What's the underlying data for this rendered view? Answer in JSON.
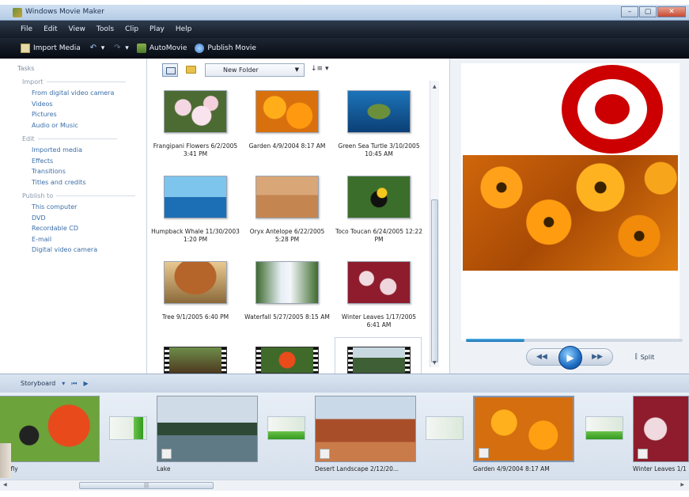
{
  "window": {
    "title": "Windows Movie Maker"
  },
  "menu": [
    "File",
    "Edit",
    "View",
    "Tools",
    "Clip",
    "Play",
    "Help"
  ],
  "toolbar": {
    "import_label": "Import Media",
    "automovie_label": "AutoMovie",
    "publish_label": "Publish Movie"
  },
  "tasks": {
    "header": "Tasks",
    "sections": [
      {
        "title": "Import",
        "links": [
          "From digital video camera",
          "Videos",
          "Pictures",
          "Audio or Music"
        ]
      },
      {
        "title": "Edit",
        "links": [
          "Imported media",
          "Effects",
          "Transitions",
          "Titles and credits"
        ]
      },
      {
        "title": "Publish to",
        "links": [
          "This computer",
          "DVD",
          "Recordable CD",
          "E-mail",
          "Digital video camera"
        ]
      }
    ]
  },
  "collection": {
    "folder_select": "New Folder",
    "sort_label": "↓≡ ▾",
    "clips": [
      {
        "caption": "Frangipani Flowers 6/2/2005 3:41 PM",
        "thumb": "frangipani"
      },
      {
        "caption": "Garden 4/9/2004 8:17 AM",
        "thumb": "garden"
      },
      {
        "caption": "Green Sea Turtle 3/10/2005 10:45 AM",
        "thumb": "turtle"
      },
      {
        "caption": "Humpback Whale 11/30/2003 1:20 PM",
        "thumb": "whale"
      },
      {
        "caption": "Oryx Antelope 6/22/2005 5:28 PM",
        "thumb": "oryx"
      },
      {
        "caption": "Toco Toucan 6/24/2005 12:22 PM",
        "thumb": "toucan"
      },
      {
        "caption": "Tree 9/1/2005 6:40 PM",
        "thumb": "tree"
      },
      {
        "caption": "Waterfall 5/27/2005 8:15 AM",
        "thumb": "waterfall"
      },
      {
        "caption": "Winter Leaves 1/17/2005 6:41 AM",
        "thumb": "leaves"
      }
    ]
  },
  "preview": {
    "seek_progress": 0.27,
    "split_label": "Split"
  },
  "storyboard": {
    "label": "Storyboard",
    "clips": [
      {
        "caption": "Butterfly"
      },
      {
        "caption": "Lake"
      },
      {
        "caption": "Desert Landscape 2/12/20..."
      },
      {
        "caption": "Garden 4/9/2004 8:17 AM"
      },
      {
        "caption": "Winter Leaves 1/1"
      }
    ]
  },
  "colors": {
    "menubar": "#1a2330",
    "accent_blue": "#1f6ec4",
    "target_red": "#cc0000"
  }
}
